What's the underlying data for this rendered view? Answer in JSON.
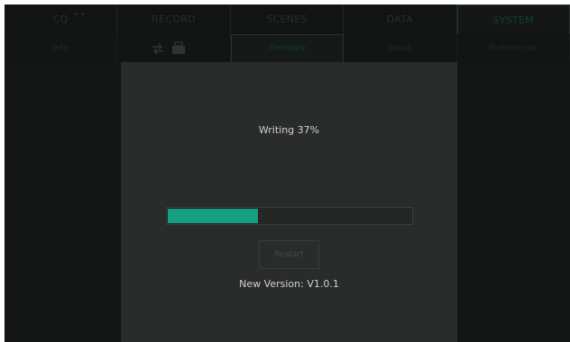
{
  "tabs": [
    {
      "label": "CQ",
      "active": false
    },
    {
      "label": "RECORD",
      "active": false
    },
    {
      "label": "SCENES",
      "active": false
    },
    {
      "label": "DATA",
      "active": false
    },
    {
      "label": "SYSTEM",
      "active": true
    }
  ],
  "subtabs": [
    {
      "label": "Info",
      "active": false
    },
    {
      "label": "",
      "active": false
    },
    {
      "label": "Firmware",
      "active": true
    },
    {
      "label": "Reset",
      "active": false
    },
    {
      "label": "Preferences",
      "active": false
    }
  ],
  "dialog": {
    "status": "Writing 37%",
    "progress": 0.37,
    "restart_label": "Restart",
    "version": "New Version: V1.0.1"
  },
  "colors": {
    "accent": "#15a083",
    "panel": "#2a2c2b",
    "background": "#141616"
  }
}
